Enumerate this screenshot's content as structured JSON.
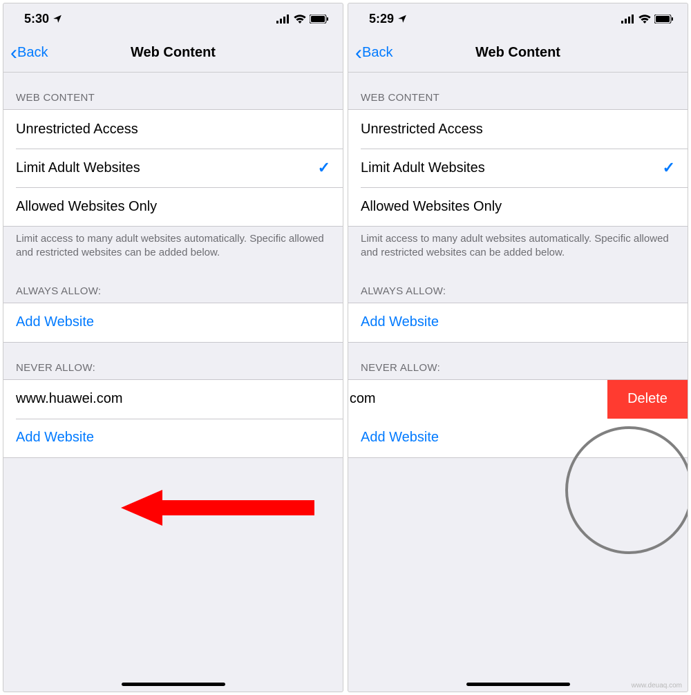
{
  "left": {
    "status": {
      "time": "5:30",
      "loc": "➤"
    },
    "nav": {
      "back": "Back",
      "title": "Web Content"
    },
    "sections": {
      "web_content_header": "WEB CONTENT",
      "options": {
        "unrestricted": "Unrestricted Access",
        "limit_adult": "Limit Adult Websites",
        "allowed_only": "Allowed Websites Only"
      },
      "footer": "Limit access to many adult websites automatically. Specific allowed and restricted websites can be added below.",
      "always_allow_header": "ALWAYS ALLOW:",
      "add_website": "Add Website",
      "never_allow_header": "NEVER ALLOW:",
      "never_item": "www.huawei.com"
    }
  },
  "right": {
    "status": {
      "time": "5:29",
      "loc": "➤"
    },
    "nav": {
      "back": "Back",
      "title": "Web Content"
    },
    "sections": {
      "web_content_header": "WEB CONTENT",
      "options": {
        "unrestricted": "Unrestricted Access",
        "limit_adult": "Limit Adult Websites",
        "allowed_only": "Allowed Websites Only"
      },
      "footer": "Limit access to many adult websites automatically. Specific allowed and restricted websites can be added below.",
      "always_allow_header": "ALWAYS ALLOW:",
      "add_website": "Add Website",
      "never_allow_header": "NEVER ALLOW:",
      "never_item": "uawei.com",
      "delete": "Delete"
    }
  },
  "watermark": "www.deuaq.com"
}
